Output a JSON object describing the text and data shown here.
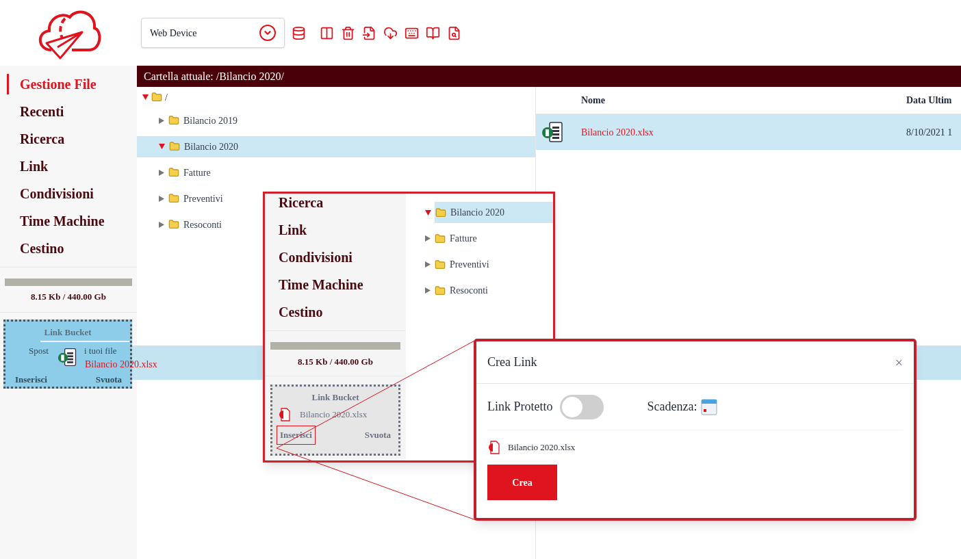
{
  "device_select": {
    "value": "Web Device"
  },
  "sidebar": {
    "items": [
      {
        "label": "Gestione File",
        "selected": true
      },
      {
        "label": "Recenti",
        "selected": false
      },
      {
        "label": "Ricerca",
        "selected": false
      },
      {
        "label": "Link",
        "selected": false
      },
      {
        "label": "Condivisioni",
        "selected": false
      },
      {
        "label": "Time Machine",
        "selected": false
      },
      {
        "label": "Cestino",
        "selected": false
      }
    ],
    "storage": "8.15 Kb / 440.00 Gb",
    "link_bucket": {
      "title": "Link Bucket",
      "hint_start": "Spost",
      "hint_end": "i tuoi file",
      "buttons": [
        "Inserisci",
        "Svuota"
      ]
    }
  },
  "drag": {
    "file": "Bilancio 2020.xlsx"
  },
  "breadcrumb": "Cartella attuale: /Bilancio 2020/",
  "tree": {
    "label": "/",
    "expanded": true,
    "children": [
      {
        "label": "Bilancio 2019",
        "expanded": false,
        "selected": false
      },
      {
        "label": "Bilancio 2020",
        "expanded": true,
        "selected": true
      },
      {
        "label": "Fatture",
        "expanded": false,
        "selected": false
      },
      {
        "label": "Preventivi",
        "expanded": false,
        "selected": false
      },
      {
        "label": "Resoconti",
        "expanded": false,
        "selected": false
      }
    ]
  },
  "file_table": {
    "columns": [
      "Nome",
      "Data Ultim"
    ],
    "rows": [
      {
        "name": "Bilancio 2020.xlsx",
        "date": "8/10/2021 1",
        "selected": true
      }
    ]
  },
  "inset": {
    "sidebar_items": [
      "Ricerca",
      "Link",
      "Condivisioni",
      "Time Machine",
      "Cestino"
    ],
    "storage": "8.15 Kb / 440.00 Gb",
    "bucket": {
      "title": "Link Bucket",
      "file": "Bilancio 2020.xlsx",
      "buttons": [
        {
          "label": "Inserisci",
          "highlighted": true
        },
        {
          "label": "Svuota",
          "highlighted": false
        }
      ]
    },
    "tree": [
      {
        "label": "Bilancio 2020",
        "expanded": true,
        "selected": true
      },
      {
        "label": "Fatture",
        "expanded": false,
        "selected": false
      },
      {
        "label": "Preventivi",
        "expanded": false,
        "selected": false
      },
      {
        "label": "Resoconti",
        "expanded": false,
        "selected": false
      }
    ]
  },
  "dialog": {
    "title": "Crea Link",
    "close": "×",
    "toggle": {
      "label": "Link Protetto",
      "on": false
    },
    "expiry_label": "Scadenza:",
    "file": "Bilancio 2020.xlsx",
    "button": "Crea"
  }
}
